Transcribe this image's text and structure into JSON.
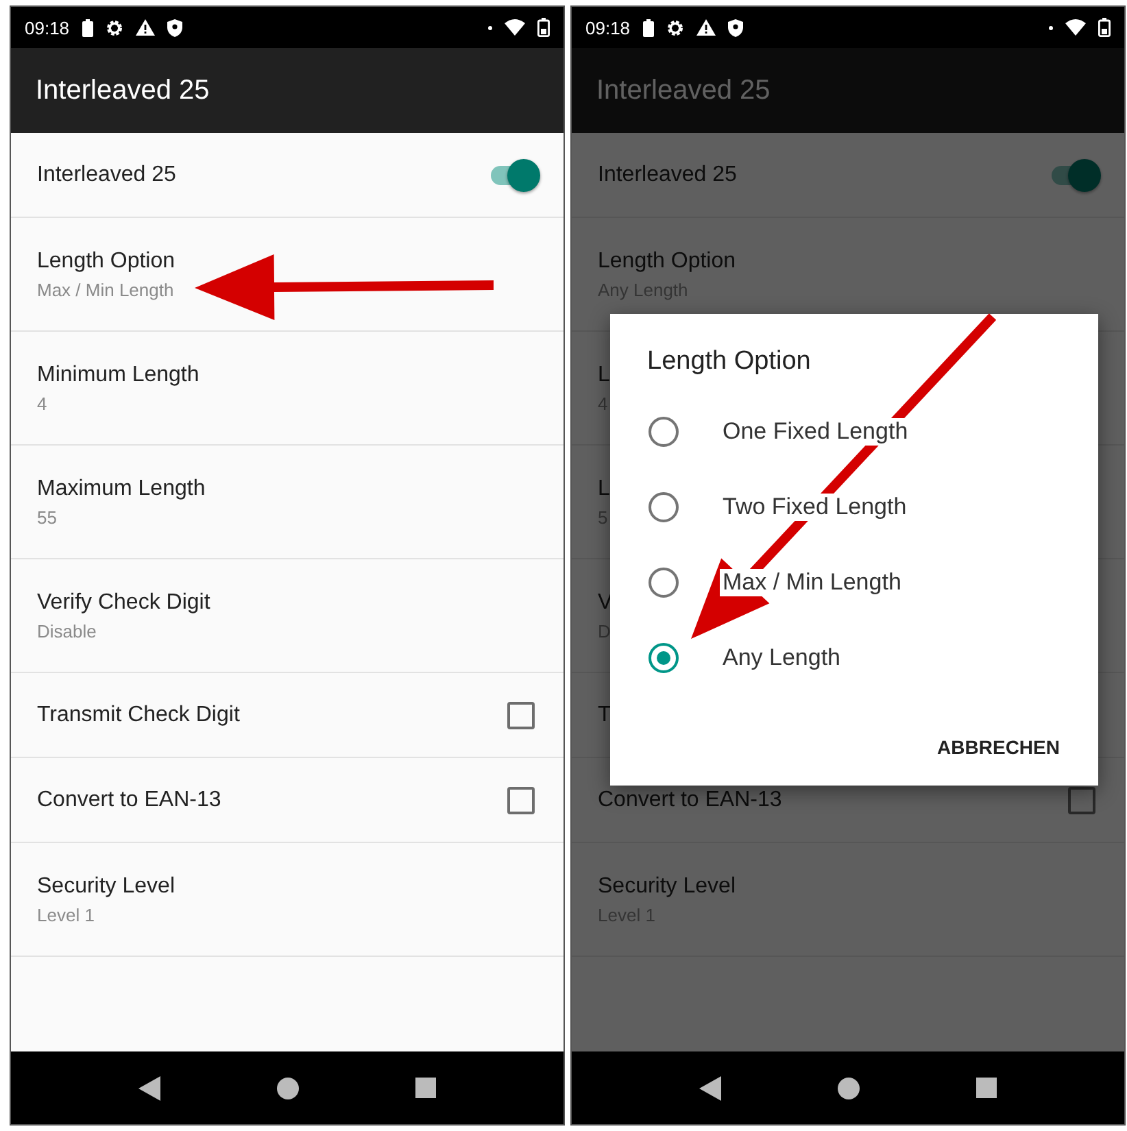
{
  "screens": [
    {
      "status_bar": {
        "time": "09:18"
      },
      "app_bar": {
        "title": "Interleaved 25"
      },
      "settings": [
        {
          "kind": "switch",
          "title": "Interleaved 25",
          "on": true
        },
        {
          "kind": "value",
          "title": "Length Option",
          "value": "Max / Min Length"
        },
        {
          "kind": "value",
          "title": "Minimum Length",
          "value": "4"
        },
        {
          "kind": "value",
          "title": "Maximum Length",
          "value": "55"
        },
        {
          "kind": "value",
          "title": "Verify Check Digit",
          "value": "Disable"
        },
        {
          "kind": "checkbox",
          "title": "Transmit Check Digit",
          "checked": false
        },
        {
          "kind": "checkbox",
          "title": "Convert to EAN-13",
          "checked": false
        },
        {
          "kind": "value",
          "title": "Security Level",
          "value": "Level 1"
        }
      ]
    },
    {
      "status_bar": {
        "time": "09:18"
      },
      "app_bar": {
        "title": "Interleaved 25"
      },
      "settings": [
        {
          "kind": "switch",
          "title": "Interleaved 25",
          "on": true
        },
        {
          "kind": "value",
          "title": "Length Option",
          "value": "Any Length"
        },
        {
          "kind": "value",
          "title": "L",
          "value": "4"
        },
        {
          "kind": "value",
          "title": "L",
          "value": "5"
        },
        {
          "kind": "value",
          "title": "V",
          "value": "D"
        },
        {
          "kind": "label",
          "title": "T"
        },
        {
          "kind": "checkbox",
          "title": "Convert to EAN-13",
          "checked": false
        },
        {
          "kind": "value",
          "title": "Security Level",
          "value": "Level 1"
        }
      ],
      "dialog": {
        "title": "Length Option",
        "options": [
          {
            "label": "One Fixed Length",
            "selected": false
          },
          {
            "label": "Two Fixed Length",
            "selected": false
          },
          {
            "label": "Max / Min Length",
            "selected": false
          },
          {
            "label": "Any Length",
            "selected": true
          }
        ],
        "buttons": [
          "ABBRECHEN"
        ]
      }
    }
  ]
}
